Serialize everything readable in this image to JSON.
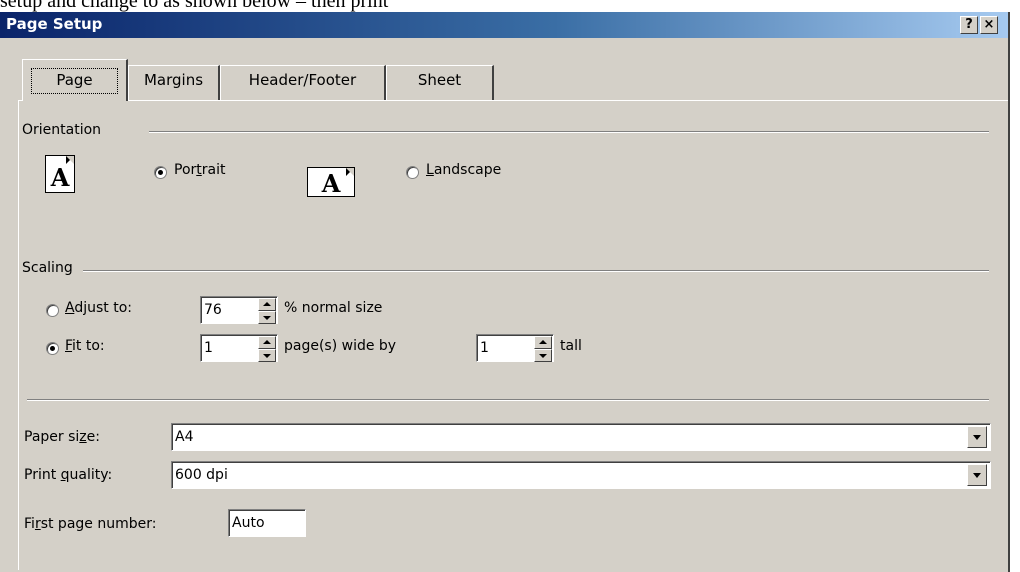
{
  "doc": {
    "caption": "setup and change to as shown below – then print"
  },
  "window": {
    "title": "Page Setup",
    "help_label": "?",
    "close_label": "×"
  },
  "tabs": [
    {
      "label": "Page",
      "active": true
    },
    {
      "label": "Margins",
      "active": false
    },
    {
      "label": "Header/Footer",
      "active": false
    },
    {
      "label": "Sheet",
      "active": false
    }
  ],
  "orientation": {
    "group_label": "Orientation",
    "portrait": {
      "label_pre": "Por",
      "label_ul": "t",
      "label_post": "rait",
      "checked": true,
      "icon_letter": "A"
    },
    "landscape": {
      "label_pre": "",
      "label_ul": "L",
      "label_post": "andscape",
      "checked": false,
      "icon_letter": "A"
    }
  },
  "scaling": {
    "group_label": "Scaling",
    "adjust": {
      "label_pre": "",
      "label_ul": "A",
      "label_post": "djust to:",
      "checked": false,
      "value": "76",
      "suffix": "% normal size"
    },
    "fit": {
      "label_pre": "",
      "label_ul": "F",
      "label_post": "it to:",
      "checked": true,
      "wide_value": "1",
      "wide_suffix": "page(s) wide by",
      "tall_value": "1",
      "tall_suffix": "tall"
    }
  },
  "paper_size": {
    "label_pre": "Paper si",
    "label_ul": "z",
    "label_post": "e:",
    "value": "A4"
  },
  "print_quality": {
    "label_pre": "Print ",
    "label_ul": "q",
    "label_post": "uality:",
    "value": "600 dpi"
  },
  "first_page": {
    "label_pre": "Fi",
    "label_ul": "r",
    "label_post": "st page number:",
    "value": "Auto"
  }
}
